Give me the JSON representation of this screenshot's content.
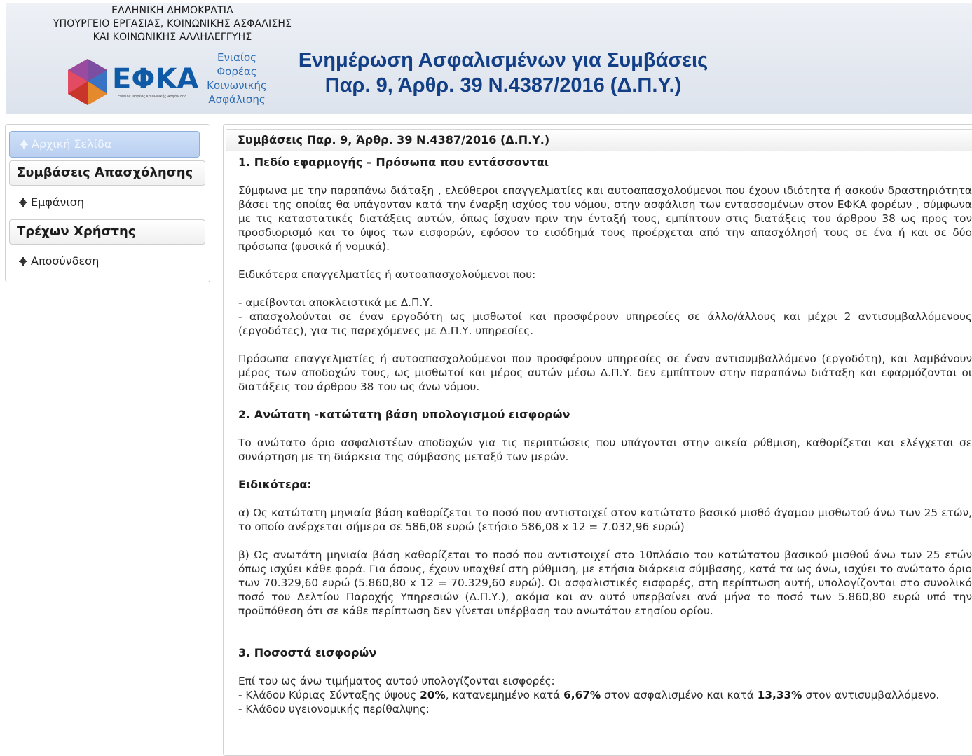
{
  "header": {
    "ministry_lines": [
      "ΕΛΛΗΝΙΚΗ ΔΗΜΟΚΡΑΤΙΑ",
      "ΥΠΟΥΡΓΕΙΟ ΕΡΓΑΣΙΑΣ, ΚΟΙΝΩΝΙΚΗΣ ΑΣΦΑΛΙΣΗΣ",
      "ΚΑΙ ΚΟΙΝΩΝΙΚΗΣ ΑΛΛΗΛΕΓΓΥΗΣ"
    ],
    "logo_text": "ΕΦΚΑ",
    "logo_tagline": "Ενιαίος Φορέας Κοινωνικής Ασφάλισης",
    "logo_side_lines": [
      "Ενιαίος",
      "Φορέας",
      "Κοινωνικής",
      "Ασφάλισης"
    ],
    "title_lines": [
      "Ενημέρωση Ασφαλισμένων για Συμβάσεις",
      "Παρ. 9, Άρθρ. 39 Ν.4387/2016 (Δ.Π.Υ.)"
    ]
  },
  "sidebar": {
    "home_label": "Αρχική Σελίδα",
    "sections": [
      {
        "title": "Συμβάσεις Απασχόλησης",
        "links": [
          "Εμφάνιση"
        ]
      },
      {
        "title": "Τρέχων Χρήστης",
        "links": [
          "Αποσύνδεση"
        ]
      }
    ]
  },
  "main": {
    "panel_title": "Συμβάσεις Παρ. 9, Άρθρ. 39 Ν.4387/2016 (Δ.Π.Υ.)",
    "s1_heading": "1. Πεδίο εφαρμογής – Πρόσωπα που εντάσσονται",
    "s1_p1": "Σύμφωνα με την παραπάνω διάταξη , ελεύθεροι επαγγελματίες και αυτοαπασχολούμενοι που έχουν ιδιότητα ή ασκούν δραστηριότητα βάσει της οποίας θα υπάγονταν κατά την έναρξη ισχύος του νόμου, στην ασφάλιση των εντασσομένων στον ΕΦΚΑ φορέων , σύμφωνα με τις καταστατικές διατάξεις αυτών, όπως ίσχυαν πριν την ένταξή τους, εμπίπτουν στις διατάξεις του άρθρου 38 ως προς τον προσδιορισμό και το ύψος των εισφορών, εφόσον το εισόδημά τους προέρχεται από την απασχόλησή τους σε ένα ή και σε δύο πρόσωπα (φυσικά ή νομικά).",
    "s1_p2": "Ειδικότερα επαγγελματίες ή αυτοαπασχολούμενοι που:",
    "s1_b1": "- αμείβονται αποκλειστικά με Δ.Π.Υ.",
    "s1_b2": "- απασχολούνται σε έναν εργοδότη ως μισθωτοί και προσφέρουν υπηρεσίες σε άλλο/άλλους και μέχρι 2 αντισυμβαλλόμενους (εργοδότες), για τις παρεχόμενες με Δ.Π.Υ. υπηρεσίες.",
    "s1_p3": "Πρόσωπα επαγγελματίες ή αυτοαπασχολούμενοι που προσφέρουν υπηρεσίες σε έναν αντισυμβαλλόμενο (εργοδότη), και λαμβάνουν μέρος των αποδοχών τους, ως μισθωτοί και μέρος αυτών μέσω Δ.Π.Υ. δεν εμπίπτουν στην παραπάνω διάταξη και εφαρμόζονται οι διατάξεις του άρθρου 38 του ως άνω νόμου.",
    "s2_heading": "2. Ανώτατη -κατώτατη βάση υπολογισμού εισφορών",
    "s2_p1": "Το ανώτατο όριο ασφαλιστέων αποδοχών για τις περιπτώσεις που υπάγονται στην οικεία ρύθμιση, καθορίζεται και ελέγχεται σε συνάρτηση με τη διάρκεια της σύμβασης μεταξύ των μερών.",
    "s2_sub": "Ειδικότερα:",
    "s2_a": "α) Ως κατώτατη μηνιαία βάση καθορίζεται το ποσό που αντιστοιχεί στον κατώτατο βασικό μισθό άγαμου μισθωτού άνω των 25 ετών, το οποίο ανέρχεται σήμερα σε 586,08 ευρώ (ετήσιο 586,08 x 12 = 7.032,96 ευρώ)",
    "s2_b": "β) Ως ανωτάτη μηνιαία βάση καθορίζεται το ποσό που αντιστοιχεί στο 10πλάσιο του κατώτατου βασικού μισθού άνω των 25 ετών όπως ισχύει κάθε φορά. Για όσους, έχουν υπαχθεί στη ρύθμιση, με ετήσια διάρκεια σύμβασης, κατά τα ως άνω, ισχύει το ανώτατο όριο των 70.329,60 ευρώ (5.860,80 x 12 = 70.329,60 ευρώ). Οι ασφαλιστικές εισφορές, στη περίπτωση αυτή, υπολογίζονται στο συνολικό ποσό του Δελτίου Παροχής Υπηρεσιών (Δ.Π.Υ.), ακόμα και αν αυτό υπερβαίνει ανά μήνα το ποσό των 5.860,80 ευρώ υπό την προϋπόθεση ότι σε κάθε περίπτωση δεν γίνεται υπέρβαση του ανωτάτου ετησίου ορίου.",
    "s3_heading": "3. Ποσοστά εισφορών",
    "s3_p1": "Επί του ως άνω τιμήματος αυτού υπολογίζονται εισφορές:",
    "s3_l1_pre": "- Κλάδου Κύριας Σύνταξης ύψους ",
    "s3_l1_b1": "20%",
    "s3_l1_mid1": ", κατανεμημένο κατά ",
    "s3_l1_b2": "6,67%",
    "s3_l1_mid2": " στον ασφαλισμένο και κατά ",
    "s3_l1_b3": "13,33%",
    "s3_l1_post": " στον αντισυμβαλλόμενο.",
    "s3_l2": "- Κλάδου υγειονομικής περίθαλψης:"
  }
}
